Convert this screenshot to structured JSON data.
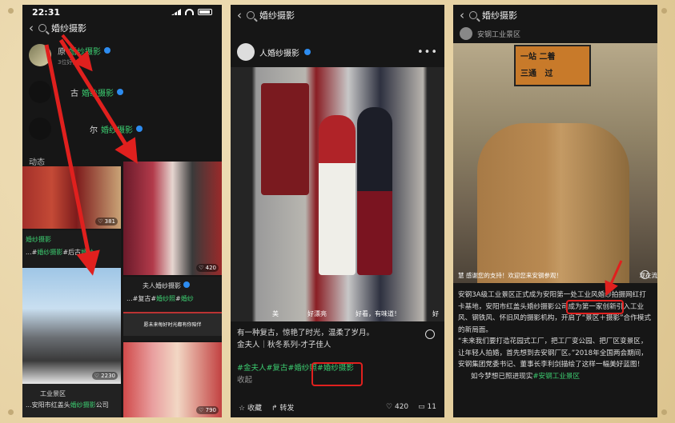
{
  "status": {
    "time": "22:31"
  },
  "search": {
    "query": "婚纱摄影"
  },
  "phone1": {
    "accounts": [
      {
        "prefix": "",
        "name_pre": "",
        "name_mid": "原",
        "name_hl": "婚纱摄影",
        "sub": "3位好友关注"
      },
      {
        "prefix": "",
        "name_pre": "古",
        "name_mid": "",
        "name_hl": "婚纱摄影",
        "sub": ""
      },
      {
        "prefix": "",
        "name_pre": "尔",
        "name_mid": "",
        "name_hl": "婚纱摄影",
        "sub": ""
      }
    ],
    "section": "动态",
    "cards": {
      "c1": {
        "likes": "381"
      },
      "c2": {
        "author_pre": "",
        "author_hl": "婚纱摄影",
        "cap_pre": "...#",
        "cap_hl1": "婚纱摄影",
        "cap_mid": "#后古",
        "cap_hl2": "婚纱"
      },
      "c3": {
        "likes": "420"
      },
      "c4": {
        "author": "夫人婚纱摄影",
        "cap_pre": "...#复古#",
        "cap_hl": "婚纱照",
        "cap_mid": "#",
        "cap_hl2": "婚纱"
      },
      "c5": {
        "likes": "2230",
        "cap1": "工业景区",
        "cap_pre": "...安阳市红盖头",
        "cap_hl": "婚纱摄影",
        "cap_post": "公司"
      },
      "c6": {
        "banner": "愿未来每好时光都有你陪伴",
        "likes": "790"
      }
    }
  },
  "phone2": {
    "author_suffix": "人婚纱摄影",
    "subtitles": [
      "美",
      "好漂亮",
      "好看，有味道！",
      "好"
    ],
    "text1": "有一种复古，惊艳了时光，温柔了岁月。",
    "text2": "金夫人｜秋冬系列-才子佳人",
    "tags": "#金夫人#复古#婚纱照#婚纱摄影",
    "fold": "收起",
    "actions": {
      "collect": "收藏",
      "share": "转发",
      "likes": "420",
      "comments": "11"
    }
  },
  "phone3": {
    "author": "安钢工业景区",
    "signs": [
      "一站",
      "二着",
      "三通",
      "过"
    ],
    "danmaku": [
      "慧 感谢您的支持！欢迎您来安钢参观！",
      "现在流"
    ],
    "para1": "安钢3A级工业景区正式成为安阳第一处工业风婚纱拍摄网红打卡基地，安阳市红盖头婚纱摄影公司成为第一家创新引入工业风、钢铁风、怀旧风的摄影机构，开启了“景区＋摄影”合作模式的新局面。",
    "para2": "“未来我们要打造花园式工厂，把工厂变公园、把厂区变景区，让年轻人拍婚，首先想到去安钢厂区。”2018年全国两会期间，安钢集团党委书记、董事长李利剑描绘了这样一幅美好蓝图！",
    "para3_pre": "如今梦想已照进现实",
    "para3_tag": "#安钢工业景区"
  },
  "colors": {
    "highlight": "#3ccc70",
    "annotation": "#e0201e",
    "background": "#e9d7ad"
  }
}
